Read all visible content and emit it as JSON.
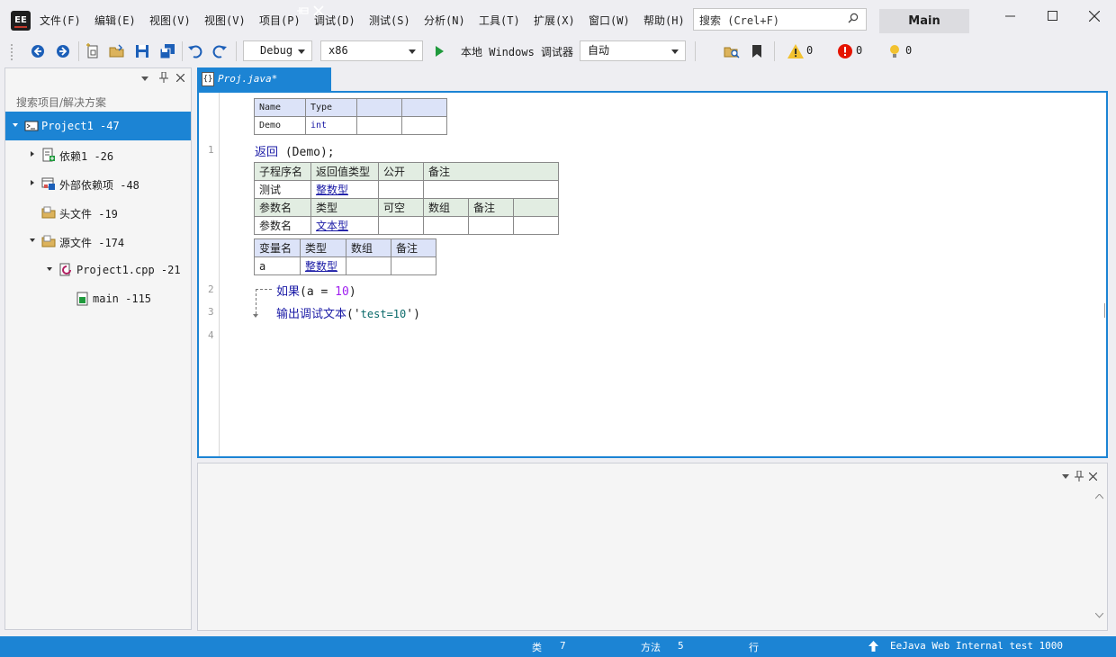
{
  "menu": [
    "文件(F)",
    "编辑(E)",
    "视图(V)",
    "视图(V)",
    "项目(P)",
    "调试(D)",
    "测试(S)",
    "分析(N)",
    "工具(T)",
    "扩展(X)",
    "窗口(W)",
    "帮助(H)"
  ],
  "search": {
    "placeholder": "搜索 (Crel+F)"
  },
  "workspace_badge": "Main",
  "toolbar": {
    "config": "Debug",
    "platform": "x86",
    "run_label": "本地 Windows 调试器",
    "mode": "自动",
    "warnings": "0",
    "errors": "0",
    "messages": "0"
  },
  "solution": {
    "search_placeholder": "搜索项目/解决方案",
    "tree": [
      {
        "label": "Project1 -47"
      },
      {
        "label": "依赖1 -26"
      },
      {
        "label": "外部依赖项 -48"
      },
      {
        "label": "头文件 -19"
      },
      {
        "label": "源文件 -174"
      },
      {
        "label": "Project1.cpp -21"
      },
      {
        "label": "main -115"
      }
    ]
  },
  "tab": {
    "label": "Proj.java*"
  },
  "editor": {
    "table1": {
      "headers": [
        "Name",
        "Type",
        "",
        ""
      ],
      "row": [
        "Demo",
        "int",
        "",
        ""
      ]
    },
    "line_numbers": [
      "1",
      "2",
      "3",
      "4"
    ],
    "line1": {
      "keyword": "返回",
      "rest": "(Demo);"
    },
    "sub_table": {
      "headers": [
        "子程序名",
        "返回值类型",
        "公开",
        "备注"
      ],
      "row": [
        "测试",
        "整数型",
        "",
        ""
      ],
      "param_headers": [
        "参数名",
        "类型",
        "可空",
        "数组",
        "备注",
        ""
      ],
      "param_row": [
        "参数名",
        "文本型",
        "",
        "",
        "",
        ""
      ]
    },
    "var_table": {
      "headers": [
        "变量名",
        "类型",
        "数组",
        "备注"
      ],
      "row": [
        "a",
        "整数型",
        "",
        ""
      ]
    },
    "line2": {
      "keyword": "如果",
      "open": "(a = ",
      "num": "10",
      "close": ")"
    },
    "line3": {
      "fn": "输出调试文本",
      "open": "('",
      "str": "test=10",
      "close": "')"
    }
  },
  "status": {
    "class_label": "类",
    "class_count": "7",
    "method_label": "方法",
    "method_count": "5",
    "row_label": "行",
    "build": "EeJava Web Internal test 1000"
  }
}
